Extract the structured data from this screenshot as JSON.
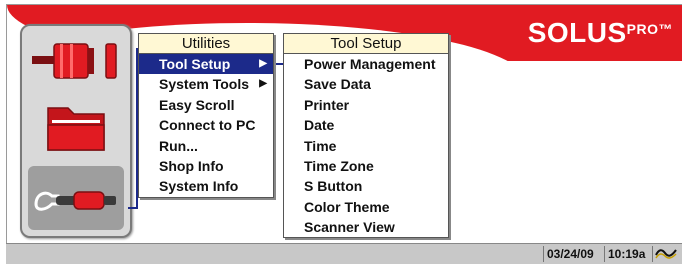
{
  "brand": {
    "name": "SOLUS",
    "suffix": "PRO",
    "tm": "™"
  },
  "sidebar": {
    "items": [
      {
        "name": "scanner-icon"
      },
      {
        "name": "folder-icon"
      },
      {
        "name": "wrench-icon",
        "selected": true
      }
    ]
  },
  "utilities_menu": {
    "title": "Utilities",
    "items": [
      {
        "label": "Tool Setup",
        "selected": true,
        "submenu": true
      },
      {
        "label": "System Tools",
        "selected": false,
        "submenu": true
      },
      {
        "label": "Easy Scroll",
        "selected": false,
        "submenu": false
      },
      {
        "label": "Connect to PC",
        "selected": false,
        "submenu": false
      },
      {
        "label": "Run...",
        "selected": false,
        "submenu": false
      },
      {
        "label": "Shop Info",
        "selected": false,
        "submenu": false
      },
      {
        "label": "System Info",
        "selected": false,
        "submenu": false
      }
    ]
  },
  "tool_setup_menu": {
    "title": "Tool Setup",
    "items": [
      {
        "label": "Power Management"
      },
      {
        "label": "Save Data"
      },
      {
        "label": "Printer"
      },
      {
        "label": "Date"
      },
      {
        "label": "Time"
      },
      {
        "label": "Time Zone"
      },
      {
        "label": "S Button"
      },
      {
        "label": "Color Theme"
      },
      {
        "label": "Scanner View"
      }
    ]
  },
  "status_bar": {
    "date": "03/24/09",
    "time": "10:19a",
    "signal_icon": "signal-wave-icon"
  },
  "colors": {
    "header_red": "#e11b22",
    "selection_blue": "#1c2a8a",
    "menu_title_bg": "#fff8d4"
  }
}
